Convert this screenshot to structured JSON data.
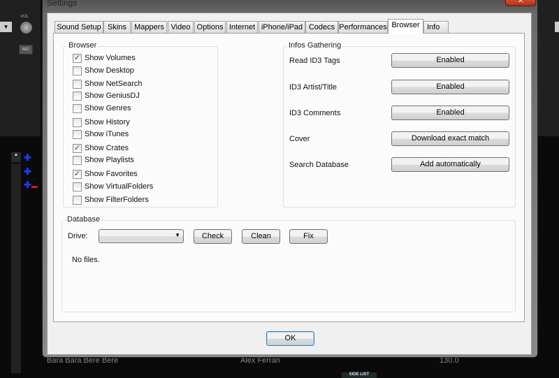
{
  "background": {
    "vol_label": "VOL",
    "rec_label": "REC",
    "track": {
      "title": "Bara Bara Bere Bere",
      "artist": "Alex Ferran",
      "bpm": "130.0"
    },
    "side_list": "SIDE LIST"
  },
  "dialog": {
    "title": "Settings",
    "close": "✕",
    "tabs": [
      "Sound Setup",
      "Skins",
      "Mappers",
      "Video",
      "Options",
      "Internet",
      "iPhone/iPad",
      "Codecs",
      "Performances",
      "Browser",
      "Info"
    ],
    "active_tab": "Browser",
    "browser_group": {
      "label": "Browser",
      "items": [
        {
          "label": "Show Volumes",
          "checked": true
        },
        {
          "label": "Show Desktop",
          "checked": false
        },
        {
          "label": "Show NetSearch",
          "checked": false
        },
        {
          "label": "Show GeniusDJ",
          "checked": false
        },
        {
          "label": "Show Genres",
          "checked": false
        },
        {
          "label": "Show History",
          "checked": false
        },
        {
          "label": "Show iTunes",
          "checked": false
        },
        {
          "label": "Show Crates",
          "checked": true
        },
        {
          "label": "Show Playlists",
          "checked": false
        },
        {
          "label": "Show Favorites",
          "checked": true
        },
        {
          "label": "Show VirtualFolders",
          "checked": false
        },
        {
          "label": "Show FilterFolders",
          "checked": false
        }
      ]
    },
    "infos_group": {
      "label": "Infos Gathering",
      "rows": [
        {
          "label": "Read ID3 Tags",
          "value": "Enabled"
        },
        {
          "label": "ID3 Artist/Title",
          "value": "Enabled"
        },
        {
          "label": "ID3 Comments",
          "value": "Enabled"
        },
        {
          "label": "Cover",
          "value": "Download exact match"
        },
        {
          "label": "Search Database",
          "value": "Add automatically"
        }
      ]
    },
    "database_group": {
      "label": "Database",
      "drive_label": "Drive:",
      "drive_value": "",
      "check": "Check",
      "clean": "Clean",
      "fix": "Fix",
      "status": "No files."
    },
    "ok": "OK"
  }
}
